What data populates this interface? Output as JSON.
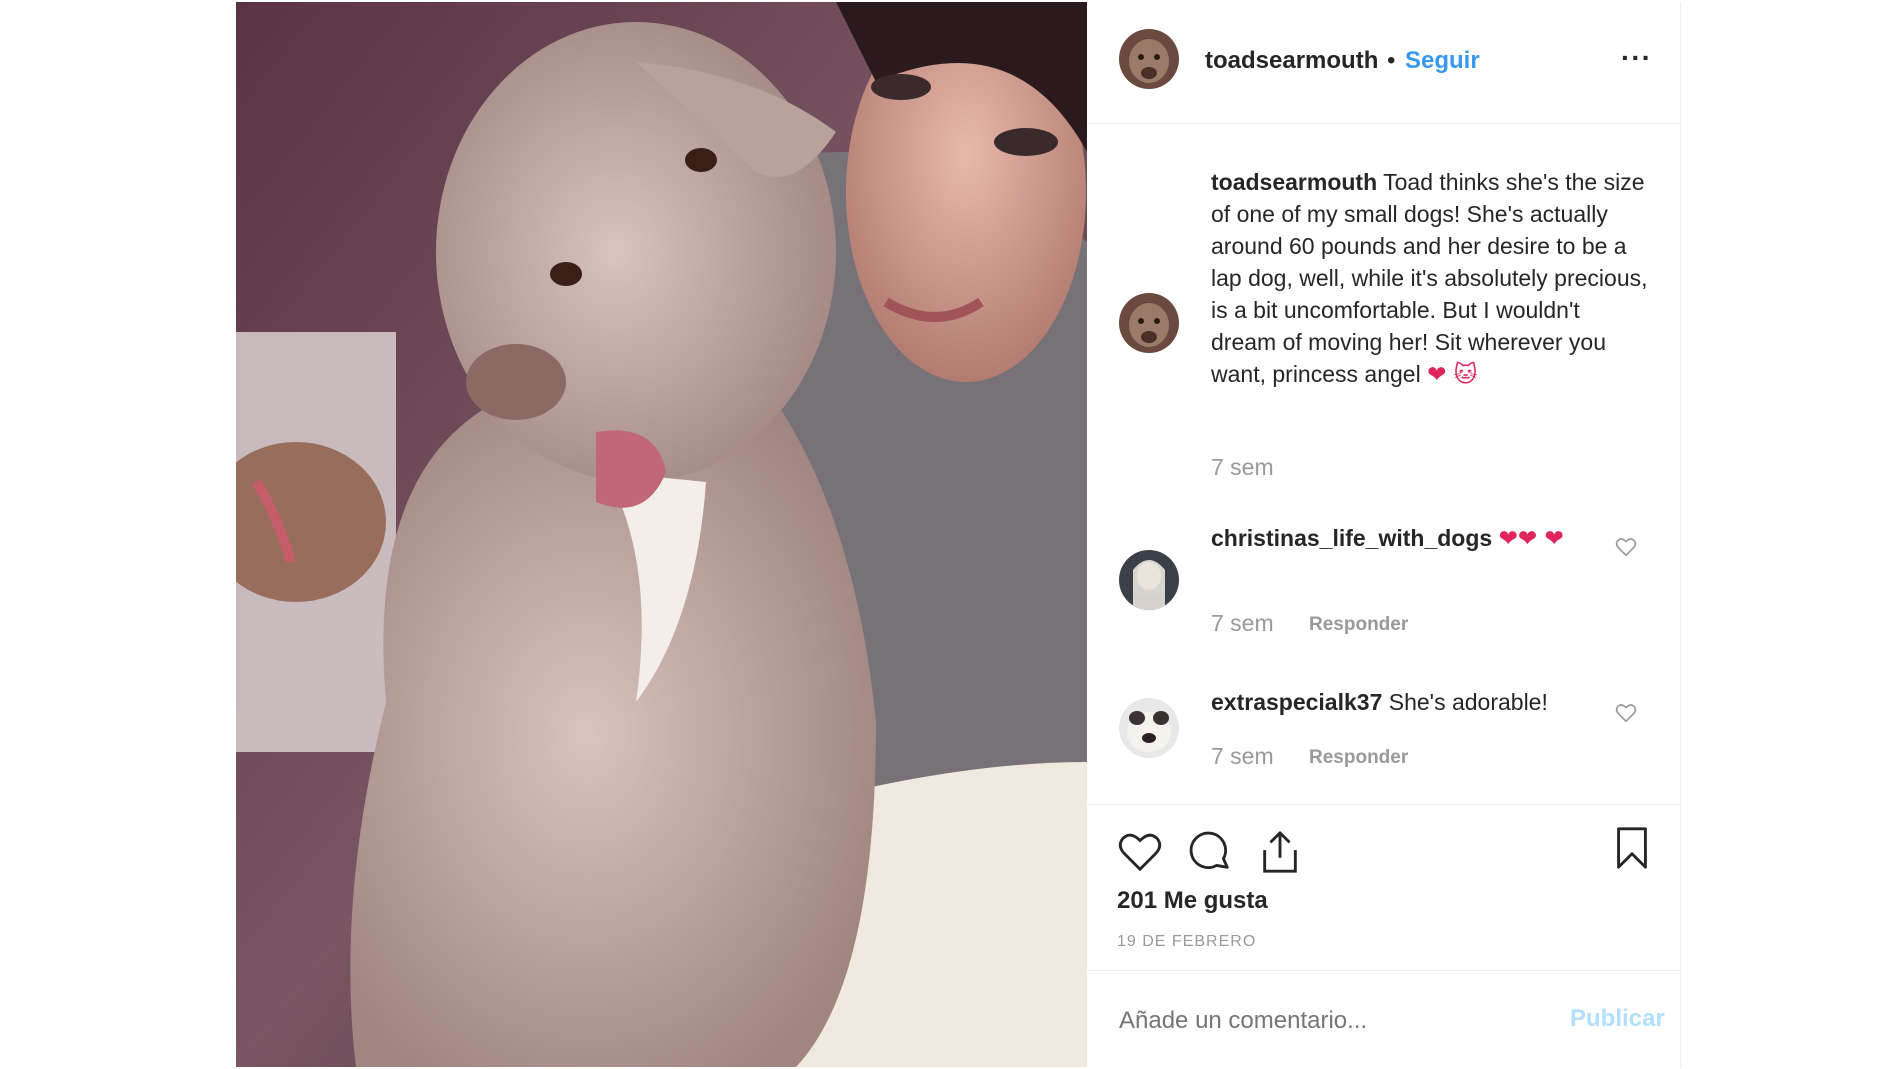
{
  "post": {
    "author": "toadsearmouth",
    "follow_label": "Seguir",
    "separator": "•",
    "more_label": "···"
  },
  "caption": {
    "username": "toadsearmouth",
    "text": "Toad thinks she's the size of one of my small dogs! She's actually around 60 pounds and her desire to be a lap dog, well, while it's absolutely precious, is a bit uncomfortable. But I wouldn't dream of moving her! Sit wherever you want, princess angel",
    "emojis": "❤ 🐱",
    "time": "7 sem"
  },
  "comments": [
    {
      "username": "christinas_life_with_dogs",
      "text": "❤❤ ❤",
      "time": "7 sem",
      "reply_label": "Responder"
    },
    {
      "username": "extraspecialk37",
      "text": "She's adorable!",
      "time": "7 sem",
      "reply_label": "Responder"
    }
  ],
  "stats": {
    "likes": "201 Me gusta",
    "date": "19 DE FEBRERO"
  },
  "comment_box": {
    "placeholder": "Añade un comentario...",
    "publish_label": "Publicar"
  },
  "icons": [
    "heart-icon",
    "comment-icon",
    "share-icon",
    "bookmark-icon",
    "more-icon"
  ],
  "colors": {
    "link_blue": "#3897f0",
    "muted_gray": "#999999",
    "publish_disabled": "#b2dffc",
    "text": "#262626"
  }
}
